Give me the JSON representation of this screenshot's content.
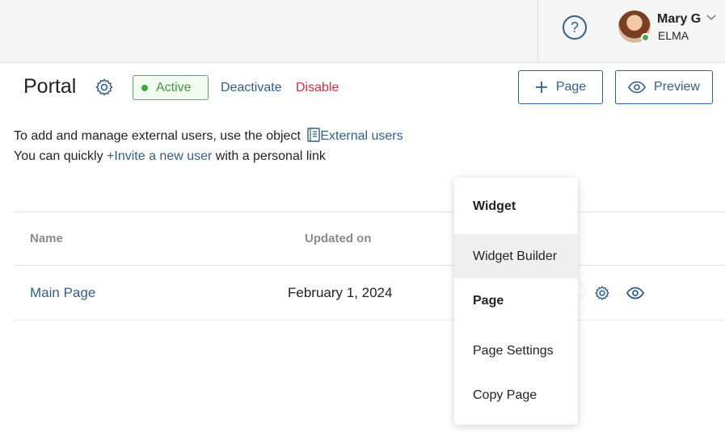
{
  "header": {
    "help_icon": "question-circle-icon",
    "user": {
      "name": "Mary G",
      "org": "ELMA",
      "status_color": "#3bb54a"
    }
  },
  "portal": {
    "title": "Portal",
    "status": "Active",
    "deactivate": "Deactivate",
    "disable": "Disable",
    "add_page": "Page",
    "preview": "Preview"
  },
  "info": {
    "line1_prefix": "To add and manage external users, use the object ",
    "line1_link": "External users",
    "line2_prefix": "You can quickly ",
    "line2_link": "+Invite a new user",
    "line2_suffix": " with a personal link"
  },
  "table": {
    "columns": [
      "Name",
      "Updated on"
    ],
    "rows": [
      {
        "name": "Main Page",
        "updated": "February 1, 2024"
      }
    ]
  },
  "context_menu": {
    "widget_header": "Widget",
    "widget_builder": "Widget Builder",
    "page_header": "Page",
    "page_settings": "Page Settings",
    "copy_page": "Copy Page"
  },
  "colors": {
    "accent": "#2f5f8f",
    "active": "#3e9b3e",
    "danger": "#d0303b"
  }
}
